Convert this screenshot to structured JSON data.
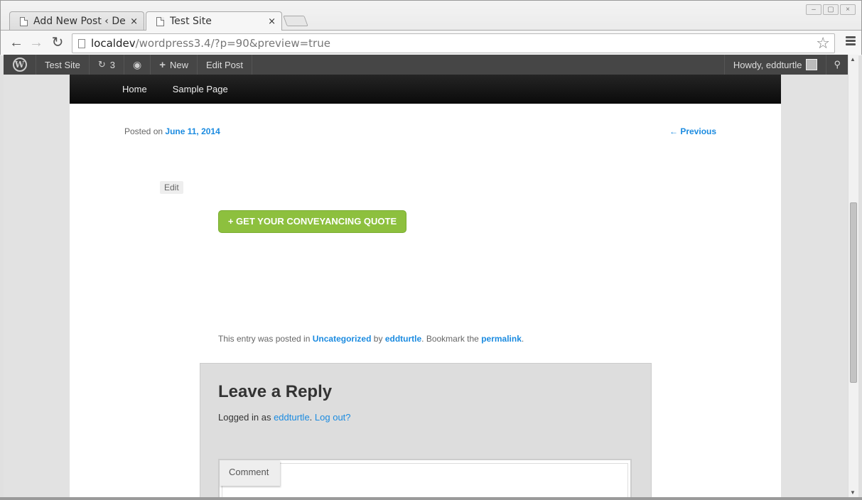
{
  "browser": {
    "tabs": [
      {
        "title": "Add New Post ‹ Desig",
        "active": false
      },
      {
        "title": "Test Site",
        "active": true
      }
    ],
    "close_glyph": "×",
    "url_host": "localdev",
    "url_path": "/wordpress3.4/?p=90&preview=true",
    "window_buttons": [
      "–",
      "▢",
      "×"
    ]
  },
  "adminbar": {
    "site_name": "Test Site",
    "updates_count": "3",
    "new_label": "New",
    "edit_post_label": "Edit Post",
    "howdy": "Howdy, eddturtle"
  },
  "site": {
    "menu": [
      "Home",
      "Sample Page"
    ]
  },
  "post": {
    "posted_on_label": "Posted on",
    "date": "June 11, 2014",
    "previous_link": "← Previous",
    "edit_label": "Edit",
    "cta_label": "+ GET YOUR CONVEYANCING QUOTE",
    "footer": {
      "prefix": "This entry was posted in",
      "category": "Uncategorized",
      "by": "by",
      "author": "eddturtle",
      "bookmark": ". Bookmark the",
      "permalink": "permalink",
      "suffix": "."
    }
  },
  "comments": {
    "title": "Leave a Reply",
    "logged_in_as": "Logged in as",
    "user": "eddturtle",
    "logout": "Log out?",
    "comment_label": "Comment"
  },
  "colors": {
    "cta_green": "#8dc03e",
    "link_blue": "#1b8be0",
    "adminbar": "#464646"
  }
}
